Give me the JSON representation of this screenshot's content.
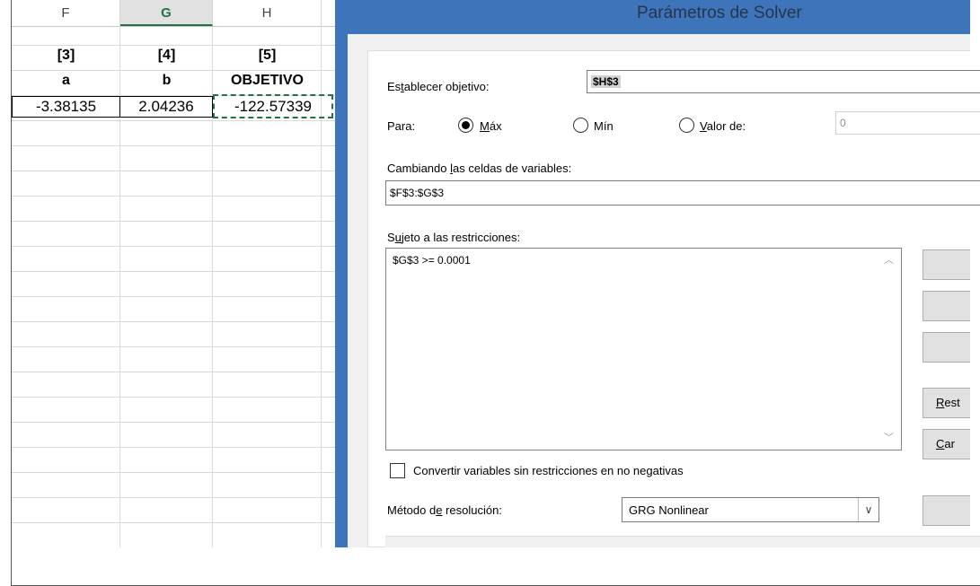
{
  "sheet": {
    "columns": [
      {
        "letter": "F",
        "active": false
      },
      {
        "letter": "G",
        "active": true
      },
      {
        "letter": "H",
        "active": false
      }
    ],
    "row_indices": [
      "[3]",
      "[4]",
      "[5]"
    ],
    "row_headers": [
      "a",
      "b",
      "OBJETIVO"
    ],
    "row_values": [
      "-3.38135",
      "2.04236",
      "-122.57339"
    ]
  },
  "dialog": {
    "title": "Parámetros de Solver",
    "objective": {
      "label_pre": "Es",
      "label_u": "t",
      "label_post": "ablecer objetivo:",
      "value": "$H$3"
    },
    "para": {
      "label": "Para:",
      "max_u": "M",
      "max_rest": "áx",
      "min_label": "Mín",
      "valor_u": "V",
      "valor_rest": "alor de:",
      "valor_value": "0",
      "selected": "max"
    },
    "variables": {
      "label_pre": "Cambiando ",
      "label_u": "l",
      "label_post": "as celdas de variables:",
      "value": "$F$3:$G$3"
    },
    "constraints": {
      "label_pre": "S",
      "label_u": "u",
      "label_post": "jeto a las restricciones:",
      "items": [
        "$G$3 >= 0.0001"
      ]
    },
    "side_buttons": {
      "reset_u": "R",
      "reset_rest": "est",
      "load_u": "C",
      "load_rest": "ar"
    },
    "nonneg_checkbox": {
      "label": "Convertir variables sin restricciones en no negativas",
      "checked": false
    },
    "method": {
      "label_pre": "Método d",
      "label_u": "e",
      "label_post": " resolución:",
      "value": "GRG Nonlinear"
    }
  }
}
